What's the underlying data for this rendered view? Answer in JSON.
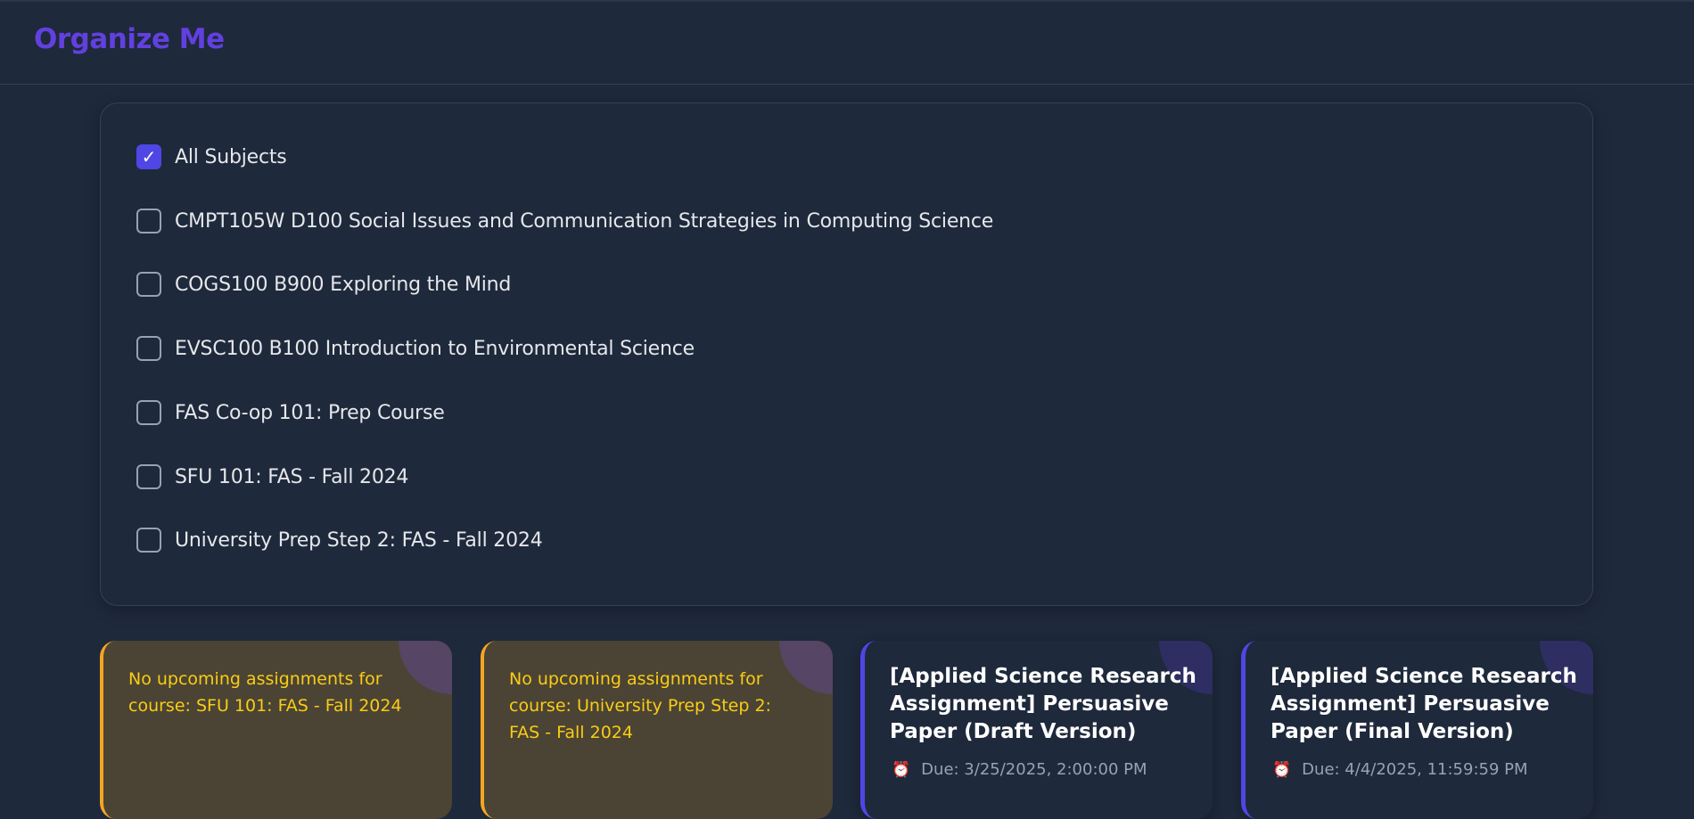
{
  "app": {
    "title": "Organize Me"
  },
  "filters": [
    {
      "label": "All Subjects",
      "checked": true
    },
    {
      "label": "CMPT105W D100 Social Issues and Communication Strategies in Computing Science",
      "checked": false
    },
    {
      "label": "COGS100 B900 Exploring the Mind",
      "checked": false
    },
    {
      "label": "EVSC100 B100 Introduction to Environmental Science",
      "checked": false
    },
    {
      "label": "FAS Co-op 101: Prep Course",
      "checked": false
    },
    {
      "label": "SFU 101: FAS - Fall 2024",
      "checked": false
    },
    {
      "label": "University Prep Step 2: FAS - Fall 2024",
      "checked": false
    }
  ],
  "cards": [
    {
      "type": "warning",
      "text": "No upcoming assignments for course: SFU 101: FAS - Fall 2024"
    },
    {
      "type": "warning",
      "text": "No upcoming assignments for course: University Prep Step 2: FAS - Fall 2024"
    },
    {
      "type": "assignment",
      "title": "[Applied Science Research Assignment] Persuasive Paper (Draft Version)",
      "due": "Due: 3/25/2025, 2:00:00 PM",
      "icon": "alarm-clock-icon"
    },
    {
      "type": "assignment",
      "title": "[Applied Science Research Assignment] Persuasive Paper (Final Version)",
      "due": "Due: 4/4/2025, 11:59:59 PM",
      "icon": "alarm-clock-icon"
    }
  ],
  "colors": {
    "brand": "#6240df",
    "accent": "#4f46e5",
    "warning": "#f5a524",
    "warning_text": "#facc15",
    "background": "#1e293b"
  }
}
